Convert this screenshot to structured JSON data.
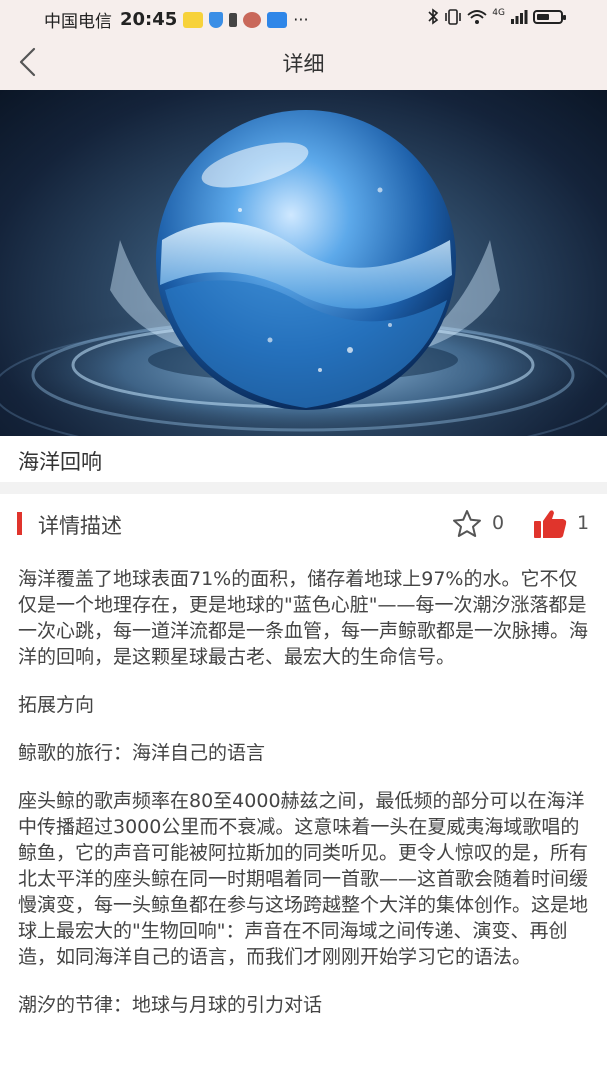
{
  "status_bar": {
    "carrier": "中国电信",
    "time": "20:45",
    "dots": "···",
    "network": "4G"
  },
  "nav": {
    "title": "详细"
  },
  "item": {
    "title": "海洋回响"
  },
  "section": {
    "title": "详情描述",
    "favorite_count": "0",
    "like_count": "1",
    "accent_color": "#e0342c"
  },
  "paragraphs": [
    "海洋覆盖了地球表面71%的面积，储存着地球上97%的水。它不仅仅是一个地理存在，更是地球的\"蓝色心脏\"——每一次潮汐涨落都是一次心跳，每一道洋流都是一条血管，每一声鲸歌都是一次脉搏。海洋的回响，是这颗星球最古老、最宏大的生命信号。",
    "拓展方向",
    "鲸歌的旅行：海洋自己的语言",
    "座头鲸的歌声频率在80至4000赫兹之间，最低频的部分可以在海洋中传播超过3000公里而不衰减。这意味着一头在夏威夷海域歌唱的鲸鱼，它的声音可能被阿拉斯加的同类听见。更令人惊叹的是，所有北太平洋的座头鲸在同一时期唱着同一首歌——这首歌会随着时间缓慢演变，每一头鲸鱼都在参与这场跨越整个大洋的集体创作。这是地球上最宏大的\"生物回响\"：声音在不同海域之间传递、演变、再创造，如同海洋自己的语言，而我们才刚刚开始学习它的语法。",
    "潮汐的节律：地球与月球的引力对话"
  ]
}
